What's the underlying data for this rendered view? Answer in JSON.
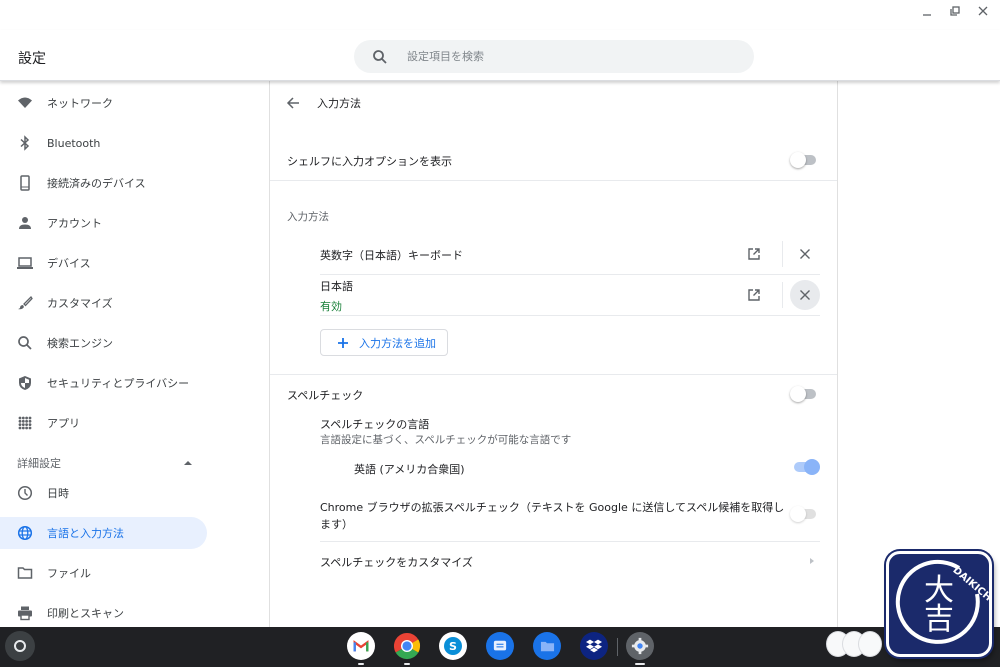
{
  "window": {
    "controls": [
      "minimize",
      "restore",
      "close"
    ]
  },
  "header": {
    "title": "設定",
    "search": {
      "placeholder": "設定項目を検索",
      "value": ""
    }
  },
  "sidebar": {
    "items": [
      {
        "label": "ネットワーク",
        "icon": "wifi-icon"
      },
      {
        "label": "Bluetooth",
        "icon": "bluetooth-icon"
      },
      {
        "label": "接続済みのデバイス",
        "icon": "phone-icon"
      },
      {
        "label": "アカウント",
        "icon": "person-icon"
      },
      {
        "label": "デバイス",
        "icon": "laptop-icon"
      },
      {
        "label": "カスタマイズ",
        "icon": "brush-icon"
      },
      {
        "label": "検索エンジン",
        "icon": "search-icon"
      },
      {
        "label": "セキュリティとプライバシー",
        "icon": "shield-icon"
      },
      {
        "label": "アプリ",
        "icon": "apps-grid-icon"
      }
    ],
    "advanced": {
      "label": "詳細設定",
      "expanded": true,
      "items": [
        {
          "label": "日時",
          "icon": "clock-icon"
        },
        {
          "label": "言語と入力方法",
          "icon": "globe-icon",
          "active": true
        },
        {
          "label": "ファイル",
          "icon": "folder-icon"
        },
        {
          "label": "印刷とスキャン",
          "icon": "printer-icon"
        }
      ]
    }
  },
  "main": {
    "title": "入力方法",
    "shelf_option": {
      "label": "シェルフに入力オプションを表示",
      "enabled": false
    },
    "input_methods": {
      "heading": "入力方法",
      "items": [
        {
          "name": "英数字（日本語）キーボード",
          "status": ""
        },
        {
          "name": "日本語",
          "status": "有効"
        }
      ],
      "add_label": "入力方法を追加"
    },
    "spellcheck": {
      "label": "スペルチェック",
      "enabled": false,
      "languages_title": "スペルチェックの言語",
      "languages_subtitle": "言語設定に基づく、スペルチェックが可能な言語です",
      "languages": [
        {
          "name": "英語 (アメリカ合衆国)",
          "enabled": true
        }
      ],
      "enhanced_label_line1": "Chrome ブラウザの拡張スペルチェック（テキストを Google に送信してスペル候補を取得し",
      "enhanced_label_line2": "ます）",
      "enhanced_enabled": false,
      "customize_label": "スペルチェックをカスタマイズ"
    }
  },
  "colors": {
    "accent": "#1a73e8",
    "active_bg": "#e8f0fe",
    "status_green": "#188038",
    "shelf_bg": "#202124",
    "logo_bg": "#1b2a6b"
  },
  "shelf": {
    "apps": [
      "Gmail",
      "Chrome",
      "Skype",
      "Messages",
      "Files",
      "Dropbox",
      "Settings"
    ]
  },
  "logo": {
    "text": "DAIKICHI",
    "glyph": "大吉"
  }
}
